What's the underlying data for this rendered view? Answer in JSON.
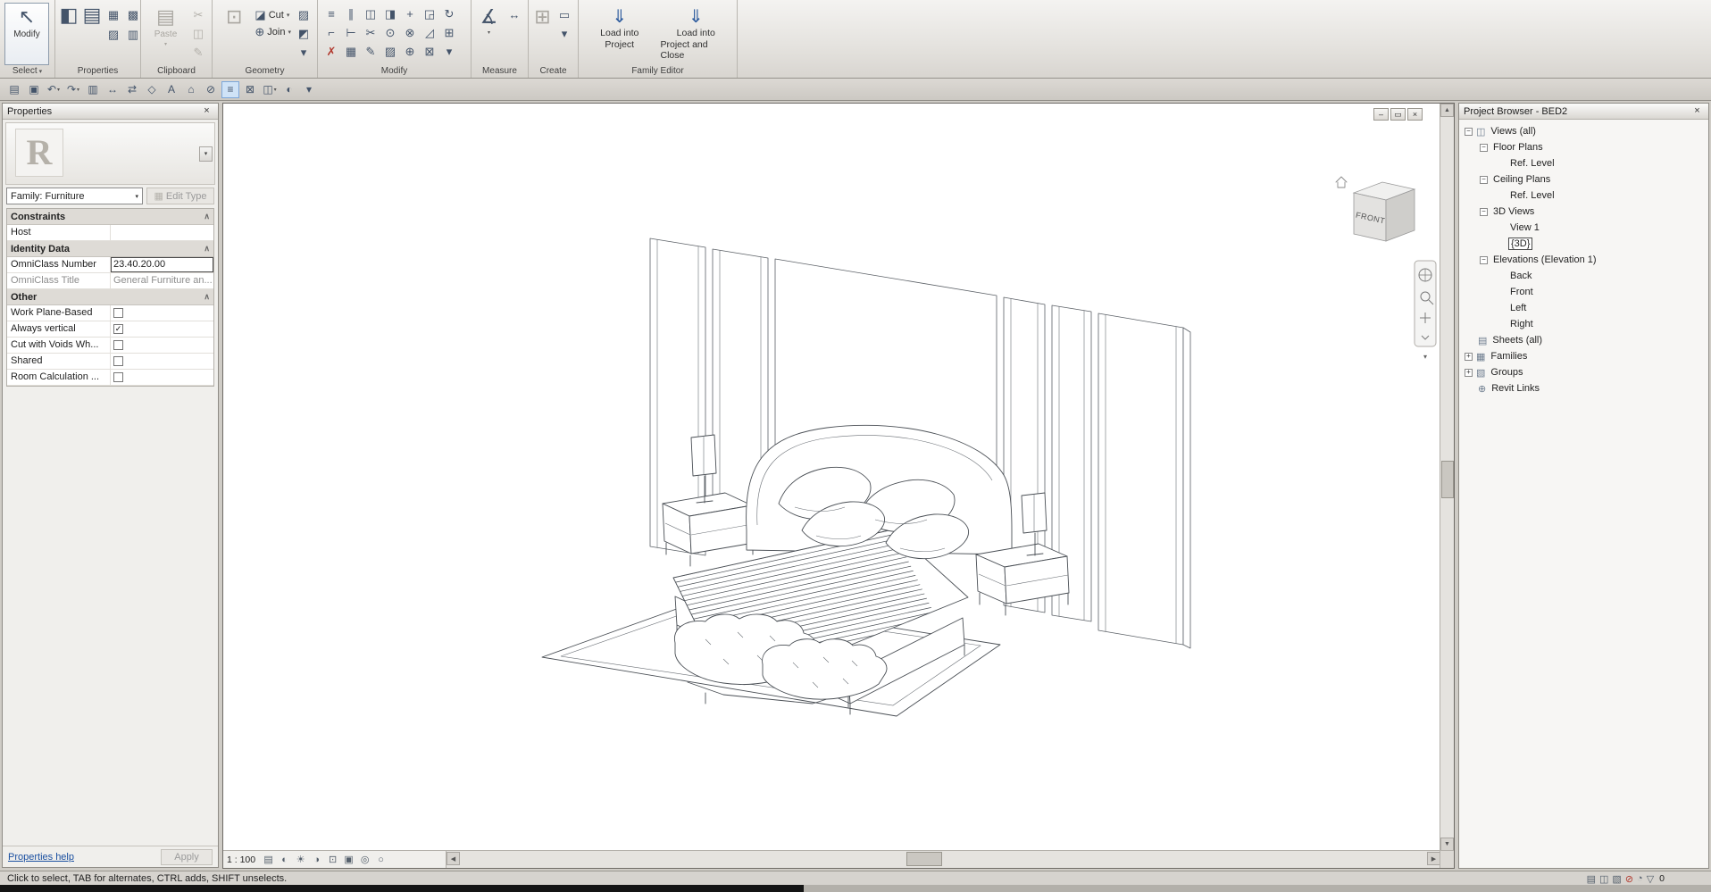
{
  "colors": {
    "accent_blue": "#4f7cb1",
    "delete_red": "#b23a2f",
    "link_blue": "#1a4fa0",
    "highlight_bg": "#cfe3f7"
  },
  "ribbon": {
    "select_panel": {
      "label": "Select",
      "caret": "▾",
      "modify_button": {
        "label": "Modify",
        "glyph": "↖"
      }
    },
    "properties_panel": {
      "label": "Properties",
      "big_icons": [
        {
          "name": "properties-palette-icon",
          "glyph": "◧"
        },
        {
          "name": "family-types-icon",
          "glyph": "▤"
        }
      ],
      "small_icons": [
        {
          "name": "family-category-icon",
          "glyph": "▦"
        },
        {
          "name": "family-parameters-icon",
          "glyph": "▩"
        },
        {
          "name": "type-properties-icon",
          "glyph": "▨"
        },
        {
          "name": "visibility-settings-icon",
          "glyph": "▥"
        }
      ]
    },
    "clipboard_panel": {
      "label": "Clipboard",
      "paste_label": "Paste",
      "paste_glyph": "▤",
      "paste_caret": "▾",
      "small_icons": [
        {
          "name": "cut-icon",
          "glyph": "✂",
          "disabled": true
        },
        {
          "name": "copy-icon",
          "glyph": "◫",
          "disabled": true
        },
        {
          "name": "match-type-icon",
          "glyph": "✎",
          "disabled": true
        }
      ]
    },
    "geometry_panel": {
      "label": "Geometry",
      "big_glyph": "⊡",
      "rows": [
        {
          "name": "cut-geometry-button",
          "label": "Cut",
          "glyph": "◪",
          "caret": "▾"
        },
        {
          "name": "join-geometry-button",
          "label": "Join",
          "glyph": "⊕",
          "caret": "▾"
        }
      ],
      "small_icons": [
        {
          "name": "paint-icon",
          "glyph": "▨"
        },
        {
          "name": "split-face-icon",
          "glyph": "◩"
        },
        {
          "name": "geometry-options-icon",
          "glyph": "▾"
        }
      ]
    },
    "modify_panel": {
      "label": "Modify",
      "tools": [
        {
          "name": "align-icon",
          "glyph": "≡"
        },
        {
          "name": "offset-icon",
          "glyph": "∥"
        },
        {
          "name": "mirror-pick-axis-icon",
          "glyph": "◫"
        },
        {
          "name": "mirror-draw-axis-icon",
          "glyph": "◨"
        },
        {
          "name": "move-icon",
          "glyph": "+"
        },
        {
          "name": "copy-icon",
          "glyph": "◲"
        },
        {
          "name": "rotate-icon",
          "glyph": "↻"
        },
        {
          "name": "trim-corner-icon",
          "glyph": "⌐"
        },
        {
          "name": "trim-extend-icon",
          "glyph": "⊢"
        },
        {
          "name": "split-element-icon",
          "glyph": "✂"
        },
        {
          "name": "pin-icon",
          "glyph": "⊙"
        },
        {
          "name": "unpin-icon",
          "glyph": "⊗"
        },
        {
          "name": "scale-icon",
          "glyph": "◿"
        },
        {
          "name": "array-icon",
          "glyph": "⊞"
        },
        {
          "name": "delete-icon",
          "glyph": "✗",
          "color": "#b23a2f"
        },
        {
          "name": "group-icon",
          "glyph": "▦"
        },
        {
          "name": "match-properties-icon",
          "glyph": "✎"
        },
        {
          "name": "paint-tool-icon",
          "glyph": "▨"
        },
        {
          "name": "join-icon",
          "glyph": "⊕"
        },
        {
          "name": "demolish-icon",
          "glyph": "⊠"
        },
        {
          "name": "more-tools-icon",
          "glyph": "▾"
        }
      ]
    },
    "measure_panel": {
      "label": "Measure",
      "big_glyph": "∡",
      "caret": "▾",
      "small_icon": {
        "name": "aligned-dimension-icon",
        "glyph": "↔"
      }
    },
    "create_panel": {
      "label": "Create",
      "big_glyph": "⊞",
      "small_icons": [
        {
          "name": "component-icon",
          "glyph": "▭"
        },
        {
          "name": "create-options-icon",
          "glyph": "▾"
        }
      ]
    },
    "family_editor_panel": {
      "label": "Family Editor",
      "buttons": [
        {
          "name": "load-into-project-button",
          "glyph": "⇓",
          "line1": "Load into",
          "line2": "Project"
        },
        {
          "name": "load-into-project-and-close-button",
          "glyph": "⇓",
          "line1": "Load into",
          "line2": "Project and Close"
        }
      ]
    }
  },
  "qat": {
    "icons": [
      {
        "name": "open-icon",
        "glyph": "▤"
      },
      {
        "name": "save-icon",
        "glyph": "▣"
      },
      {
        "name": "undo-icon",
        "glyph": "↶",
        "caret": true
      },
      {
        "name": "redo-icon",
        "glyph": "↷",
        "caret": true
      },
      {
        "name": "print-icon",
        "glyph": "▥"
      },
      {
        "name": "measure-icon",
        "glyph": "↔"
      },
      {
        "name": "aligned-dimension-icon",
        "glyph": "⇄"
      },
      {
        "name": "tag-by-category-icon",
        "glyph": "◇"
      },
      {
        "name": "text-icon",
        "glyph": "A"
      },
      {
        "name": "default-3d-view-icon",
        "glyph": "⌂"
      },
      {
        "name": "section-icon",
        "glyph": "⊘"
      },
      {
        "name": "thin-lines-icon",
        "glyph": "≡",
        "active": true
      },
      {
        "name": "close-inactive-windows-icon",
        "glyph": "⊠"
      },
      {
        "name": "switch-windows-icon",
        "glyph": "◫",
        "caret": true
      },
      {
        "name": "visual-style-icon",
        "glyph": "◐"
      },
      {
        "name": "customize-qat-icon",
        "glyph": "▾"
      }
    ]
  },
  "properties": {
    "title": "Properties",
    "close_glyph": "×",
    "preview_letter": "R",
    "type_caret": "▾",
    "family_value": "Family: Furniture",
    "family_caret": "▾",
    "edit_type_glyph": "▦",
    "edit_type_label": "Edit Type",
    "groups": [
      {
        "header": "Constraints",
        "caret": "∧",
        "rows": [
          {
            "label": "Host",
            "type": "text",
            "value": ""
          }
        ]
      },
      {
        "header": "Identity Data",
        "caret": "∧",
        "rows": [
          {
            "label": "OmniClass Number",
            "type": "text",
            "value": "23.40.20.00",
            "focus": true
          },
          {
            "label": "OmniClass Title",
            "type": "text",
            "value": "General Furniture an...",
            "dim": true
          }
        ]
      },
      {
        "header": "Other",
        "caret": "∧",
        "rows": [
          {
            "label": "Work Plane-Based",
            "type": "checkbox",
            "checked": false
          },
          {
            "label": "Always vertical",
            "type": "checkbox",
            "checked": true
          },
          {
            "label": "Cut with Voids Wh...",
            "type": "checkbox",
            "checked": false
          },
          {
            "label": "Shared",
            "type": "checkbox",
            "checked": false
          },
          {
            "label": "Room Calculation ...",
            "type": "checkbox",
            "checked": false
          }
        ]
      }
    ],
    "check_glyph": "✓",
    "help_link": "Properties help",
    "apply_label": "Apply"
  },
  "browser": {
    "title": "Project Browser - BED2",
    "close_glyph": "×",
    "tree": [
      {
        "label": "Views (all)",
        "depth": 0,
        "expander": "minus",
        "icon": "views-icon",
        "glyph": "◫"
      },
      {
        "label": "Floor Plans",
        "depth": 1,
        "expander": "minus"
      },
      {
        "label": "Ref. Level",
        "depth": 2
      },
      {
        "label": "Ceiling Plans",
        "depth": 1,
        "expander": "minus"
      },
      {
        "label": "Ref. Level",
        "depth": 2
      },
      {
        "label": "3D Views",
        "depth": 1,
        "expander": "minus"
      },
      {
        "label": "View 1",
        "depth": 2
      },
      {
        "label": "{3D}",
        "depth": 2,
        "selected": true
      },
      {
        "label": "Elevations (Elevation 1)",
        "depth": 1,
        "expander": "minus"
      },
      {
        "label": "Back",
        "depth": 2
      },
      {
        "label": "Front",
        "depth": 2
      },
      {
        "label": "Left",
        "depth": 2
      },
      {
        "label": "Right",
        "depth": 2
      },
      {
        "label": "Sheets (all)",
        "depth": 0,
        "icon": "sheets-icon",
        "glyph": "▤"
      },
      {
        "label": "Families",
        "depth": 0,
        "expander": "plus",
        "icon": "families-icon",
        "glyph": "▦"
      },
      {
        "label": "Groups",
        "depth": 0,
        "expander": "plus",
        "icon": "groups-icon",
        "glyph": "▧"
      },
      {
        "label": "Revit Links",
        "depth": 0,
        "icon": "revit-links-icon",
        "glyph": "⊕"
      }
    ]
  },
  "viewport": {
    "window_buttons": [
      {
        "name": "minimize-view-icon",
        "glyph": "–"
      },
      {
        "name": "restore-view-icon",
        "glyph": "▭"
      },
      {
        "name": "close-view-icon",
        "glyph": "×"
      }
    ],
    "viewcube_front": "FRONT",
    "scale": "1 : 100",
    "view_controls": [
      {
        "name": "detail-level-icon",
        "glyph": "▤"
      },
      {
        "name": "visual-style-icon",
        "glyph": "◐"
      },
      {
        "name": "sun-settings-icon",
        "glyph": "☀"
      },
      {
        "name": "shadows-icon",
        "glyph": "◑"
      },
      {
        "name": "crop-view-icon",
        "glyph": "⊡"
      },
      {
        "name": "show-crop-region-icon",
        "glyph": "▣"
      },
      {
        "name": "temporary-hide-isolate-icon",
        "glyph": "◎"
      },
      {
        "name": "reveal-hidden-elements-icon",
        "glyph": "○"
      }
    ],
    "scroll": {
      "left": "◀",
      "right": "▶",
      "up": "▲",
      "down": "▼"
    }
  },
  "status": {
    "message": "Click to select, TAB for alternates, CTRL adds, SHIFT unselects.",
    "right_icons": [
      {
        "name": "worksets-icon",
        "glyph": "▤"
      },
      {
        "name": "design-options-icon",
        "glyph": "◫"
      },
      {
        "name": "editable-only-icon",
        "glyph": "▧"
      },
      {
        "name": "exclude-options-icon",
        "glyph": "⊘",
        "color": "#b23a2f"
      },
      {
        "name": "background-processes-icon",
        "glyph": "◔"
      },
      {
        "name": "filter-icon",
        "glyph": "▽"
      }
    ],
    "count": "0"
  }
}
